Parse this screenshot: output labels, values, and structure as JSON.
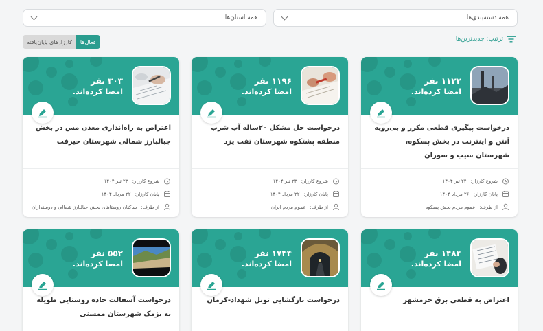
{
  "filters": {
    "category": "همه دسته‌بندی‌ها",
    "province": "همه استان‌ها"
  },
  "sort": {
    "label": "ترتیب: جدیدترین‌ها"
  },
  "toggle": {
    "active": "فعال‌ها",
    "finished": "کارزارهای پایان‌یافته"
  },
  "meta_labels": {
    "start": "شروع کارزار:",
    "end": "پایان کارزار:",
    "by": "از طرف:"
  },
  "campaigns": [
    {
      "count": "۱۱۲۲ نفر",
      "signed": "امضا کرده‌اند.",
      "title": "درخواست پیگیری قطعی مکرر و بی‌رویه آنتن و اینترنت در بخش پسکوه، شهرستان سیب و سوران",
      "start": "۲۴ تیر ۱۴۰۴",
      "end": "۲۶ مرداد ۱۴۰۴",
      "by": "عموم مردم بخش پسکوه"
    },
    {
      "count": "۱۱۹۶ نفر",
      "signed": "امضا کرده‌اند.",
      "title": "درخواست حل مشکل ۲۰ساله آب شرب منطقه پشتکوه شهرستان تفت یزد",
      "start": "۲۳ تیر ۱۴۰۴",
      "end": "۲۲ مرداد ۱۴۰۴",
      "by": "عموم مردم ایران"
    },
    {
      "count": "۳۰۳ نفر",
      "signed": "امضا کرده‌اند.",
      "title": "اعتراض به راه‌اندازی معدن مس در بخش جبالبارز شمالی شهرستان جیرفت",
      "start": "۲۳ تیر ۱۴۰۴",
      "end": "۲۲ مرداد ۱۴۰۴",
      "by": "ساکنان روستاهای بخش جبالبارز شمالی و دوستداران ..."
    },
    {
      "count": "۱۴۸۴ نفر",
      "signed": "امضا کرده‌اند.",
      "title": "اعتراض به قطعی برق خرمشهر"
    },
    {
      "count": "۱۷۴۴ نفر",
      "signed": "امضا کرده‌اند.",
      "title": "درخواست بازگشایی تونل شهداد-کرمان"
    },
    {
      "count": "۵۵۲ نفر",
      "signed": "امضا کرده‌اند.",
      "title": "درخواست آسفالت جاده روستایی طویله به بزمک شهرستان ممسنی"
    }
  ],
  "colors": {
    "accent": "#2aa594",
    "page_bg": "#f4f5f6"
  }
}
